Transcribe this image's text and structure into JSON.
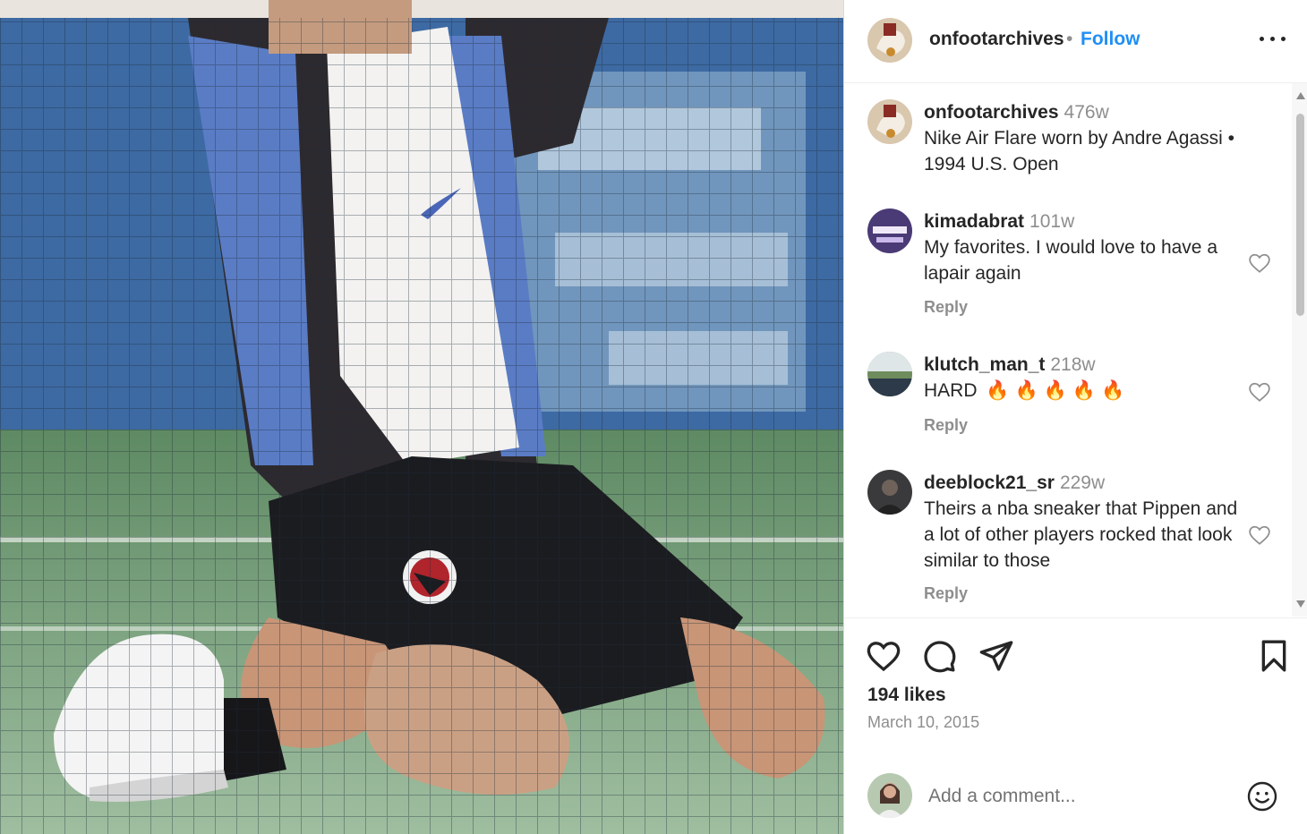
{
  "header": {
    "username": "onfootarchives",
    "separator": "•",
    "follow_label": "Follow",
    "more_icon": "more-horizontal-icon"
  },
  "comments": [
    {
      "username": "onfootarchives",
      "time": "476w",
      "text": "Nike Air Flare worn by Andre Agassi • 1994 U.S. Open",
      "reply": null,
      "liked": false
    },
    {
      "username": "kimadabrat",
      "time": "101w",
      "text": "My favorites. I would love to have a lapair again",
      "reply": "Reply",
      "liked": false
    },
    {
      "username": "klutch_man_t",
      "time": "218w",
      "text": "HARD",
      "emoji": "🔥🔥🔥🔥🔥",
      "reply": "Reply",
      "liked": false
    },
    {
      "username": "deeblock21_sr",
      "time": "229w",
      "text": "Theirs a nba sneaker that Pippen and a lot of other players rocked that look similar to those",
      "reply": "Reply",
      "liked": false
    }
  ],
  "actions": {
    "like_icon": "heart-icon",
    "comment_icon": "comment-bubble-icon",
    "share_icon": "paper-plane-icon",
    "save_icon": "bookmark-icon"
  },
  "likes": "194 likes",
  "date": "March 10, 2015",
  "add_comment": {
    "placeholder": "Add a comment...",
    "emoji_icon": "smiley-icon"
  },
  "colors": {
    "follow": "#1f8ff5",
    "muted": "#8e8e8e",
    "text": "#262626",
    "divider": "#efefef"
  }
}
